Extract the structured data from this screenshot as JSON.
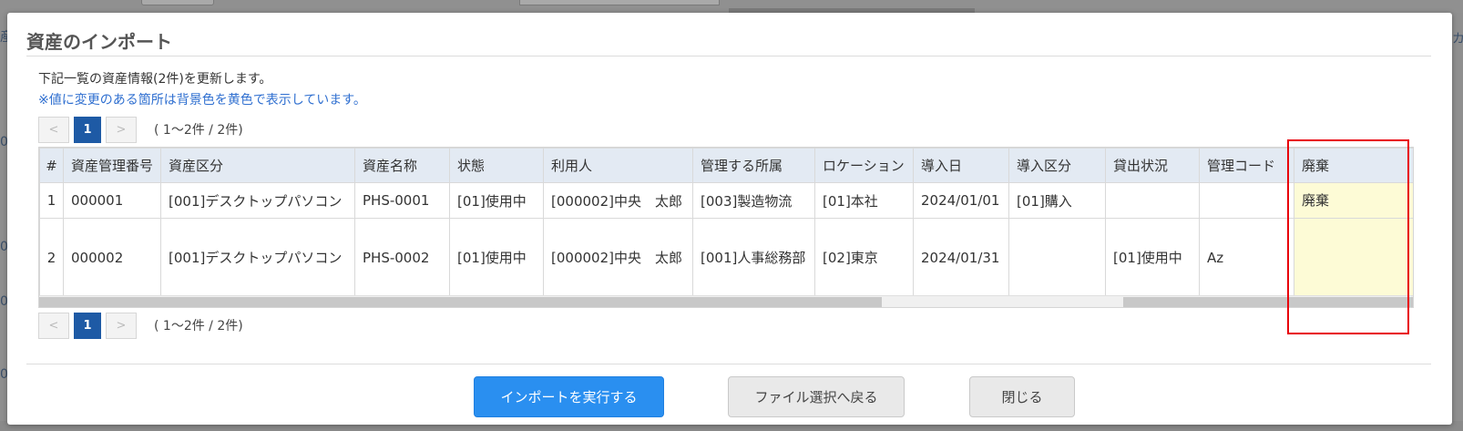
{
  "background": {
    "frag_left_top": "産",
    "frag_left_rows": [
      "0",
      "0",
      "0",
      "0"
    ],
    "frag_right": "カ"
  },
  "modal": {
    "title": "資産のインポート",
    "message": "下記一覧の資産情報(2件)を更新します。",
    "note": "※値に変更のある箇所は背景色を黄色で表示しています。",
    "note_color": "#2f6fd0",
    "changed_cell_color": "#fdfbd6",
    "highlight_color": "#e8000b"
  },
  "pager": {
    "prev": "<",
    "current_page": "1",
    "next": ">",
    "info": "( 1～2件 / 2件)"
  },
  "table": {
    "headers": [
      "#",
      "資産管理番号",
      "資産区分",
      "資産名称",
      "状態",
      "利用人",
      "管理する所属",
      "ロケーション",
      "導入日",
      "導入区分",
      "貸出状況",
      "管理コード",
      "廃棄"
    ],
    "rows": [
      {
        "no": "1",
        "asset_no": "000001",
        "category": "[001]デスクトップパソコン",
        "name": "PHS-0001",
        "status": "[01]使用中",
        "user": "[000002]中央　太郎",
        "department": "[003]製造物流",
        "location": "[01]本社",
        "intro_date": "2024/01/01",
        "intro_type": "[01]購入",
        "lending": "",
        "mgmt_code": "",
        "disposal": "廃棄"
      },
      {
        "no": "2",
        "asset_no": "000002",
        "category": "[001]デスクトップパソコン",
        "name": "PHS-0002",
        "status": "[01]使用中",
        "user": "[000002]中央　太郎",
        "department": "[001]人事総務部",
        "location": "[02]東京",
        "intro_date": "2024/01/31",
        "intro_type": "",
        "lending": "[01]使用中",
        "mgmt_code": "Az",
        "disposal": ""
      }
    ]
  },
  "buttons": {
    "execute": "インポートを実行する",
    "back": "ファイル選択へ戻る",
    "close": "閉じる"
  }
}
